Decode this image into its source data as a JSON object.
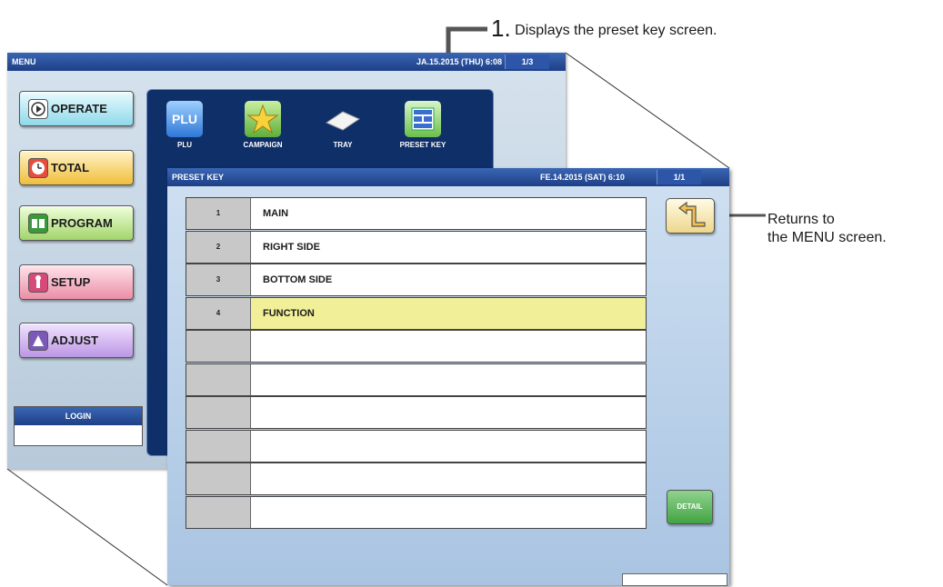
{
  "menu_screen": {
    "title": "MENU",
    "datetime": "JA.15.2015 (THU)  6:08",
    "page": "1/3",
    "buttons": [
      "OPERATE",
      "TOTAL",
      "PROGRAM",
      "SETUP",
      "ADJUST"
    ],
    "icons": [
      "PLU",
      "CAMPAIGN",
      "TRAY",
      "PRESET KEY"
    ],
    "plu_icon_text": "PLU",
    "login_label": "LOGIN"
  },
  "preset_screen": {
    "title": "PRESET KEY",
    "datetime": "FE.14.2015 (SAT)  6:10",
    "page": "1/1",
    "rows": [
      {
        "num": "1",
        "name": "MAIN"
      },
      {
        "num": "2",
        "name": "RIGHT SIDE"
      },
      {
        "num": "3",
        "name": "BOTTOM SIDE"
      },
      {
        "num": "4",
        "name": "FUNCTION"
      },
      {
        "num": "",
        "name": ""
      },
      {
        "num": "",
        "name": ""
      },
      {
        "num": "",
        "name": ""
      },
      {
        "num": "",
        "name": ""
      },
      {
        "num": "",
        "name": ""
      },
      {
        "num": "",
        "name": ""
      }
    ],
    "selected_row": 4,
    "detail_label": "DETAIL"
  },
  "callouts": {
    "step_number": "1.",
    "step_text": "Displays the preset key screen.",
    "return_line1": "Returns to",
    "return_line2": "the MENU screen."
  }
}
